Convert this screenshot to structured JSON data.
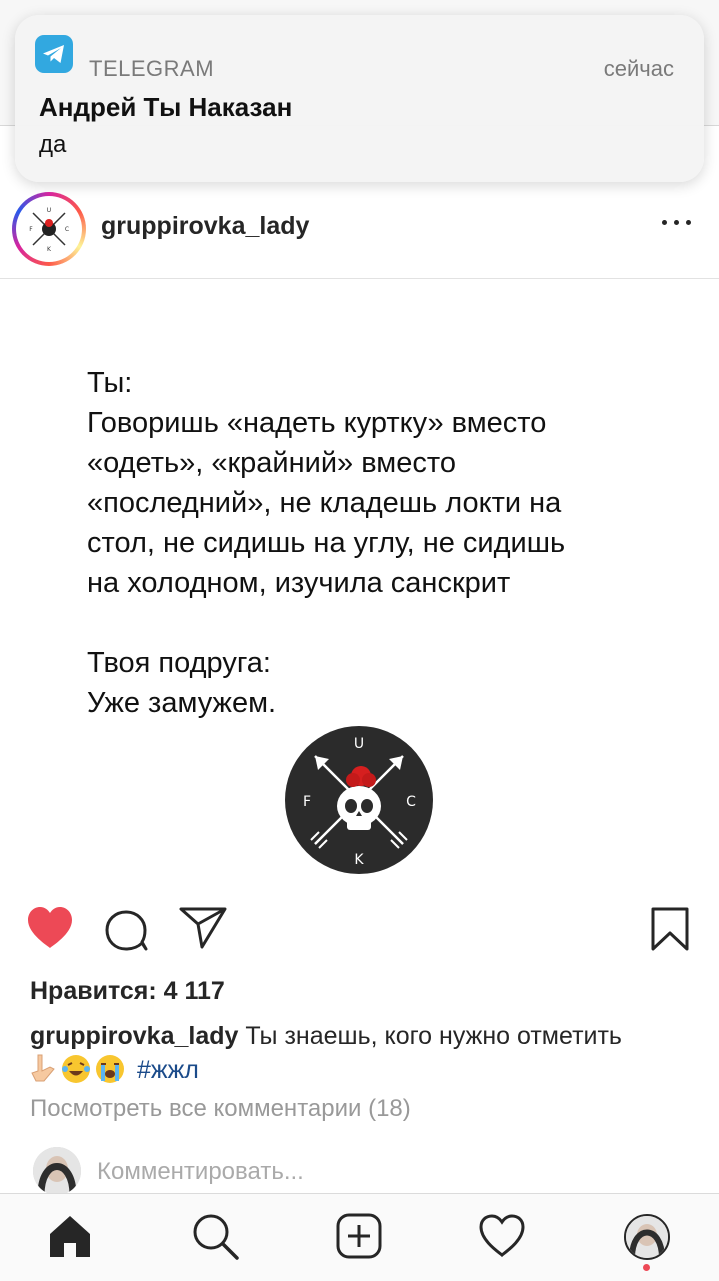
{
  "notification": {
    "app_name": "TELEGRAM",
    "time": "сейчас",
    "title": "Андрей Ты Наказан",
    "message": "да",
    "app_icon": "telegram-icon"
  },
  "post": {
    "username": "gruppirovka_lady",
    "image_text": {
      "line1": "Ты:",
      "line2": "Говоришь «надеть куртку» вместо",
      "line3": "«одеть», «крайний» вместо",
      "line4": "«последний», не кладешь локти на",
      "line5": "стол, не сидишь на углу, не сидишь",
      "line6": "на холодном, изучила санскрит",
      "line7": "Твоя подруга:",
      "line8": "Уже замужем."
    },
    "logo_letters": {
      "top": "U",
      "left": "F",
      "right": "C",
      "bottom": "K"
    },
    "likes": "Нравится: 4 117",
    "caption_username": "gruppirovka_lady",
    "caption_text": "Ты знаешь, кого нужно отметить",
    "caption_emojis": [
      "👇",
      "😂",
      "😭"
    ],
    "hashtag": "#жжл",
    "view_comments": "Посмотреть все комментарии (18)",
    "comment_placeholder": "Комментировать..."
  },
  "colors": {
    "like_red": "#ed4956",
    "telegram_blue": "#32a8e0",
    "hashtag_blue": "#1b4b8a"
  },
  "tabbar": [
    "home-icon",
    "search-icon",
    "new-post-icon",
    "activity-icon",
    "profile-avatar"
  ]
}
